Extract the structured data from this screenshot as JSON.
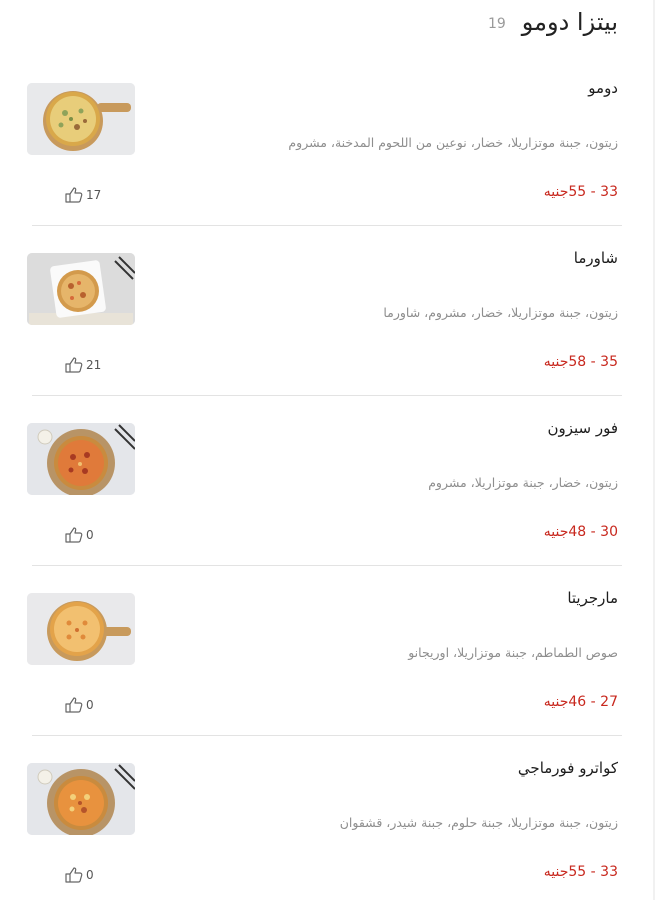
{
  "category": {
    "title": "بيتزا دومو",
    "count": "19"
  },
  "items": [
    {
      "name": "دومو",
      "description": "زيتون، جبنة موتزاريلا، خضار، نوعين من اللحوم المدخنة، مشروم",
      "price": "33 - 55جنيه",
      "likes": "17",
      "image_icon": "pizza-on-board-photo"
    },
    {
      "name": "شاورما",
      "description": "زيتون، جبنة موتزاريلا، خضار، مشروم، شاورما",
      "price": "35 - 58جنيه",
      "likes": "21",
      "image_icon": "pizza-on-plate-photo"
    },
    {
      "name": "فور سيزون",
      "description": "زيتون، خضار، جبنة موتزاريلا، مشروم",
      "price": "30 - 48جنيه",
      "likes": "0",
      "image_icon": "pizza-on-mat-photo"
    },
    {
      "name": "مارجريتا",
      "description": "صوص الطماطم، جبنة موتزاريلا، اوريجانو",
      "price": "27 - 46جنيه",
      "likes": "0",
      "image_icon": "pizza-on-board-photo"
    },
    {
      "name": "كواترو فورماجي",
      "description": "زيتون، جبنة موتزاريلا، جبنة حلوم، جبنة شيدر، قشقوان",
      "price": "33 - 55جنيه",
      "likes": "0",
      "image_icon": "pizza-on-mat-photo"
    }
  ],
  "colors": {
    "price": "#c8281e",
    "muted": "#8e8e8e",
    "title": "#222222"
  }
}
